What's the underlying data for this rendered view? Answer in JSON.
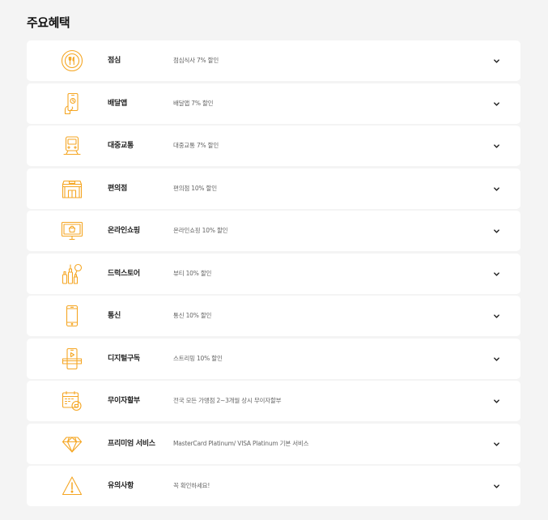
{
  "section": {
    "title": "주요혜택"
  },
  "colors": {
    "accent": "#f5a623",
    "background": "#f4f4f4",
    "card": "#ffffff",
    "text": "#222222",
    "subtext": "#666666"
  },
  "benefits": [
    {
      "name": "점심",
      "desc": "점심식사 7% 할인",
      "icon": "lunch-icon"
    },
    {
      "name": "배달앱",
      "desc": "배달앱 7% 할인",
      "icon": "delivery-app-icon"
    },
    {
      "name": "대중교통",
      "desc": "대중교통 7% 할인",
      "icon": "transit-icon"
    },
    {
      "name": "편의점",
      "desc": "편의점 10% 할인",
      "icon": "convenience-store-icon"
    },
    {
      "name": "온라인쇼핑",
      "desc": "온라인쇼핑 10% 할인",
      "icon": "online-shopping-icon"
    },
    {
      "name": "드럭스토어",
      "desc": "뷰티 10% 할인",
      "icon": "drugstore-icon"
    },
    {
      "name": "통신",
      "desc": "통신 10% 할인",
      "icon": "telecom-icon"
    },
    {
      "name": "디지털구독",
      "desc": "스트리밍 10% 할인",
      "icon": "digital-subscription-icon"
    },
    {
      "name": "무이자할부",
      "desc": "전국 모든 가맹점 2~3개월 상시 무이자할부",
      "icon": "installment-calendar-icon"
    },
    {
      "name": "프리미엄 서비스",
      "desc": "MasterCard Platinum/ VISA Platinum 기본 서비스",
      "icon": "diamond-icon"
    },
    {
      "name": "유의사항",
      "desc": "꼭 확인하세요!",
      "icon": "warning-icon"
    }
  ]
}
